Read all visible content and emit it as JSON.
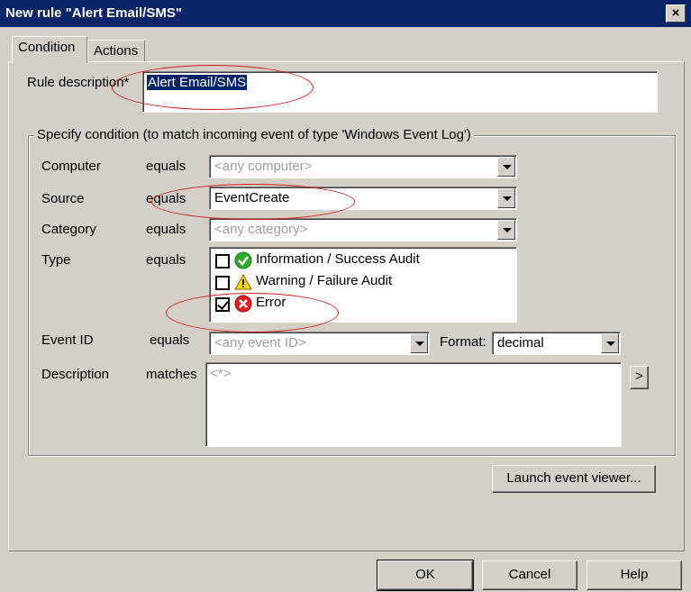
{
  "window": {
    "title": "New rule \"Alert Email/SMS\"",
    "close_label": "×"
  },
  "tabs": [
    {
      "label": "Condition"
    },
    {
      "label": "Actions"
    }
  ],
  "rule": {
    "label": "Rule description*",
    "value": "Alert Email/SMS"
  },
  "condition": {
    "legend": "Specify condition (to match incoming event of type 'Windows Event Log')",
    "computer": {
      "label": "Computer",
      "op": "equals",
      "placeholder": "<any computer>"
    },
    "source": {
      "label": "Source",
      "op": "equals",
      "value": "EventCreate"
    },
    "category": {
      "label": "Category",
      "op": "equals",
      "placeholder": "<any category>"
    },
    "type": {
      "label": "Type",
      "op": "equals",
      "options": [
        {
          "label": "Information / Success Audit",
          "checked": false,
          "icon": "success-icon"
        },
        {
          "label": "Warning / Failure Audit",
          "checked": false,
          "icon": "warning-icon"
        },
        {
          "label": "Error",
          "checked": true,
          "icon": "error-icon"
        }
      ]
    },
    "event_id": {
      "label": "Event ID",
      "op": "equals",
      "placeholder": "<any event ID>"
    },
    "format": {
      "label": "Format:",
      "value": "decimal"
    },
    "description": {
      "label": "Description",
      "op": "matches",
      "placeholder": "<*>",
      "expand_label": ">"
    }
  },
  "buttons": {
    "launch": "Launch event viewer...",
    "ok": "OK",
    "cancel": "Cancel",
    "help": "Help"
  },
  "colors": {
    "title_bar": "#0a246a",
    "face": "#d4d0c8",
    "highlight": "#0a246a",
    "annotation": "#d02020"
  }
}
